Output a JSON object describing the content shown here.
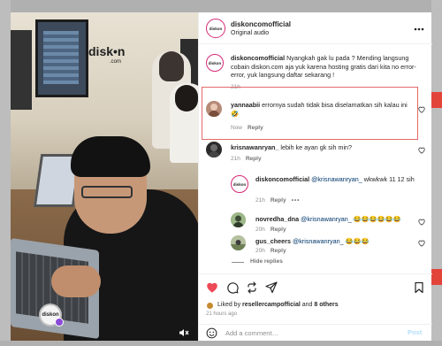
{
  "video": {
    "logo_text": "disk•n",
    "logo_sub": ".com",
    "badge_text": "diskon"
  },
  "header": {
    "username": "diskoncomofficial",
    "audio": "Original audio",
    "avatar_text": "diskon"
  },
  "caption": {
    "username": "diskoncomofficial",
    "text": "Nyangkah gak lu pada ? Mending langsung cobain diskon.com aja yuk karena hosting gratis dari kita no error-error, yuk langsung daftar sekarang !",
    "time": "21h"
  },
  "comments": [
    {
      "username": "yannaabii",
      "text": "errornya sudah tidak bisa diselamatkan sih kalau ini 🤣",
      "time": "Now",
      "reply": "Reply"
    },
    {
      "username": "krisnawanryan_",
      "text": "lebih ke ayan gk sih min?",
      "time": "21h",
      "reply": "Reply"
    }
  ],
  "replies": [
    {
      "username": "diskoncomofficial",
      "mention": "@krisnawanryan_",
      "text": "wkwkwk 11 12 sih",
      "time": "21h",
      "reply": "Reply",
      "more": "•••",
      "avatar_text": "diskon"
    },
    {
      "username": "novredha_dna",
      "mention": "@krisnawanryan_",
      "text": "😂😂😂😂😂😂",
      "time": "20h",
      "reply": "Reply"
    },
    {
      "username": "gus_cheers",
      "mention": "@krisnawanryan_",
      "text": "😂😂😂",
      "time": "20h",
      "reply": "Reply"
    }
  ],
  "hide_replies": "Hide replies",
  "likes": {
    "prefix": "Liked by",
    "user": "resellercampofficial",
    "joiner": "and",
    "others": "8 others"
  },
  "posted_ago": "21 hours ago",
  "comment_input": {
    "placeholder": "Add a comment…",
    "post_label": "Post"
  },
  "icons": [
    "heart-icon",
    "comment-icon",
    "repost-icon",
    "share-icon",
    "save-icon",
    "emoji-icon",
    "mute-icon",
    "more-icon"
  ],
  "colors": {
    "like_red": "#ed4956",
    "highlight_border": "#e36a6a",
    "mention_blue": "#00376b",
    "post_disabled": "#b2dffc"
  }
}
